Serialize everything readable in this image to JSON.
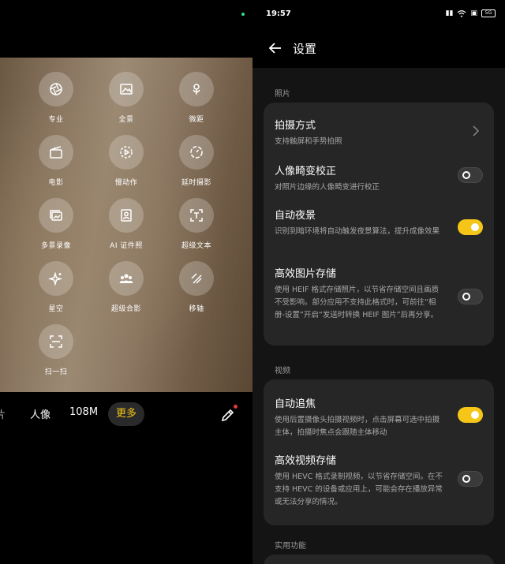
{
  "camera": {
    "modes": [
      {
        "label": "专业",
        "icon": "aperture-icon"
      },
      {
        "label": "全景",
        "icon": "panorama-icon"
      },
      {
        "label": "微距",
        "icon": "flower-macro-icon"
      },
      {
        "label": "电影",
        "icon": "clapperboard-icon"
      },
      {
        "label": "慢动作",
        "icon": "slow-motion-icon"
      },
      {
        "label": "延时摄影",
        "icon": "timelapse-icon"
      },
      {
        "label": "多景录像",
        "icon": "multi-scene-video-icon"
      },
      {
        "label": "AI 证件照",
        "icon": "id-photo-icon"
      },
      {
        "label": "超级文本",
        "icon": "super-text-icon"
      },
      {
        "label": "星空",
        "icon": "starry-sky-icon"
      },
      {
        "label": "超级合影",
        "icon": "group-photo-icon"
      },
      {
        "label": "移轴",
        "icon": "tilt-shift-icon"
      },
      {
        "label": "扫一扫",
        "icon": "scan-icon"
      }
    ],
    "bottom_bar": {
      "partial_label": "片",
      "portrait_label": "人像",
      "megapixel_label": "108M",
      "more_label": "更多"
    }
  },
  "status_bar": {
    "time": "19:57",
    "wifi": "wifi-icon",
    "network_badge": "5G"
  },
  "settings": {
    "title": "设置",
    "sections": {
      "photo": {
        "title": "照片",
        "rows": [
          {
            "title": "拍摄方式",
            "subtitle": "支持触屏和手势拍照",
            "control": "chevron"
          },
          {
            "title": "人像畸变校正",
            "subtitle": "对照片边缘的人像畸变进行校正",
            "control": "toggle",
            "on": false
          },
          {
            "title": "自动夜景",
            "subtitle": "识别到暗环境将自动触发夜景算法，提升成像效果",
            "control": "toggle",
            "on": true
          },
          {
            "title": "高效图片存储",
            "subtitle": "使用 HEIF 格式存储照片，以节省存储空间且画质不受影响。部分应用不支持此格式时，可前往“相册-设置”开启“发送时转换 HEIF 图片”后再分享。",
            "control": "toggle",
            "on": false
          }
        ]
      },
      "video": {
        "title": "视频",
        "rows": [
          {
            "title": "自动追焦",
            "subtitle": "使用后置摄像头拍摄视频时，点击屏幕可选中拍摄主体，拍摄时焦点会跟随主体移动",
            "control": "toggle",
            "on": true
          },
          {
            "title": "高效视频存储",
            "subtitle": "使用 HEVC 格式录制视频，以节省存储空间。在不支持 HEVC 的设备或应用上，可能会存在播放异常或无法分享的情况。",
            "control": "toggle",
            "on": false
          }
        ]
      },
      "utility": {
        "title": "实用功能"
      }
    }
  },
  "colors": {
    "accent": "#f5c518",
    "card": "#262626",
    "background": "#141414"
  }
}
